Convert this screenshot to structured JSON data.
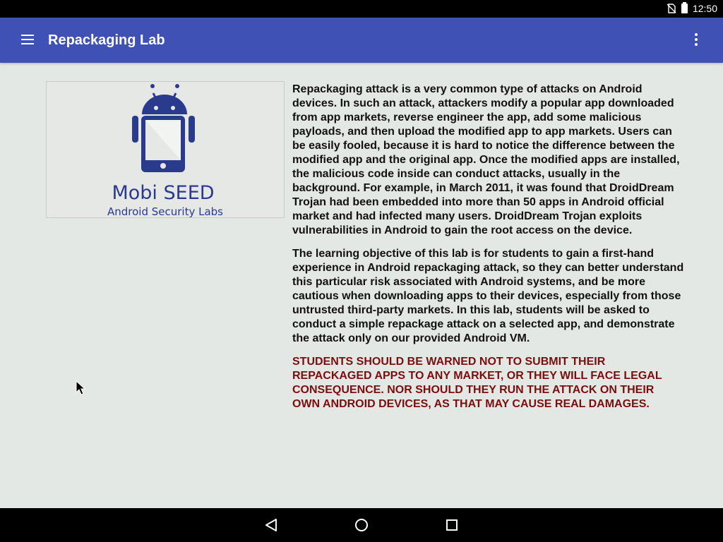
{
  "status_bar": {
    "time": "12:50",
    "icons": [
      "no-sim-icon",
      "battery-icon"
    ]
  },
  "app_bar": {
    "title": "Repackaging Lab",
    "menu_icon": "hamburger-menu-icon",
    "overflow_icon": "more-vert-icon",
    "color": "#3f51b5"
  },
  "logo": {
    "name": "Mobi SEED",
    "subtitle": "Android Security Labs",
    "color": "#2a3a8c"
  },
  "content": {
    "paragraph1": "Repackaging attack is a very common type of attacks on Android devices. In such an attack, attackers modify a popular app downloaded from app markets, reverse engineer the app, add some malicious payloads, and then upload the modified app to app markets. Users can be easily fooled, because it is hard to notice the difference between the modified app and the original app. Once the modified apps are installed, the malicious code inside can conduct attacks, usually in the background. For example, in March 2011, it was found that DroidDream Trojan had been embedded into more than 50 apps in Android official market and had infected many users. DroidDream Trojan exploits vulnerabilities in Android to gain the root access on the device.",
    "paragraph2": "The learning objective of this lab is for students to gain a first-hand experience in Android repackaging attack, so they can better understand this particular risk associated with Android systems, and be more cautious when downloading apps to their devices, especially from those untrusted third-party markets. In this lab, students will be asked to conduct a simple repackage attack on a selected app, and demonstrate the attack only on our provided Android VM.",
    "warning": "STUDENTS SHOULD BE WARNED NOT TO SUBMIT THEIR REPACKAGED APPS TO ANY MARKET, OR THEY WILL FACE LEGAL CONSEQUENCE. NOR SHOULD THEY RUN THE ATTACK ON THEIR OWN ANDROID DEVICES, AS THAT MAY CAUSE REAL DAMAGES.",
    "warning_color": "#7a0e0e"
  },
  "nav_bar": {
    "buttons": [
      "back-icon",
      "home-icon",
      "recents-icon"
    ]
  }
}
